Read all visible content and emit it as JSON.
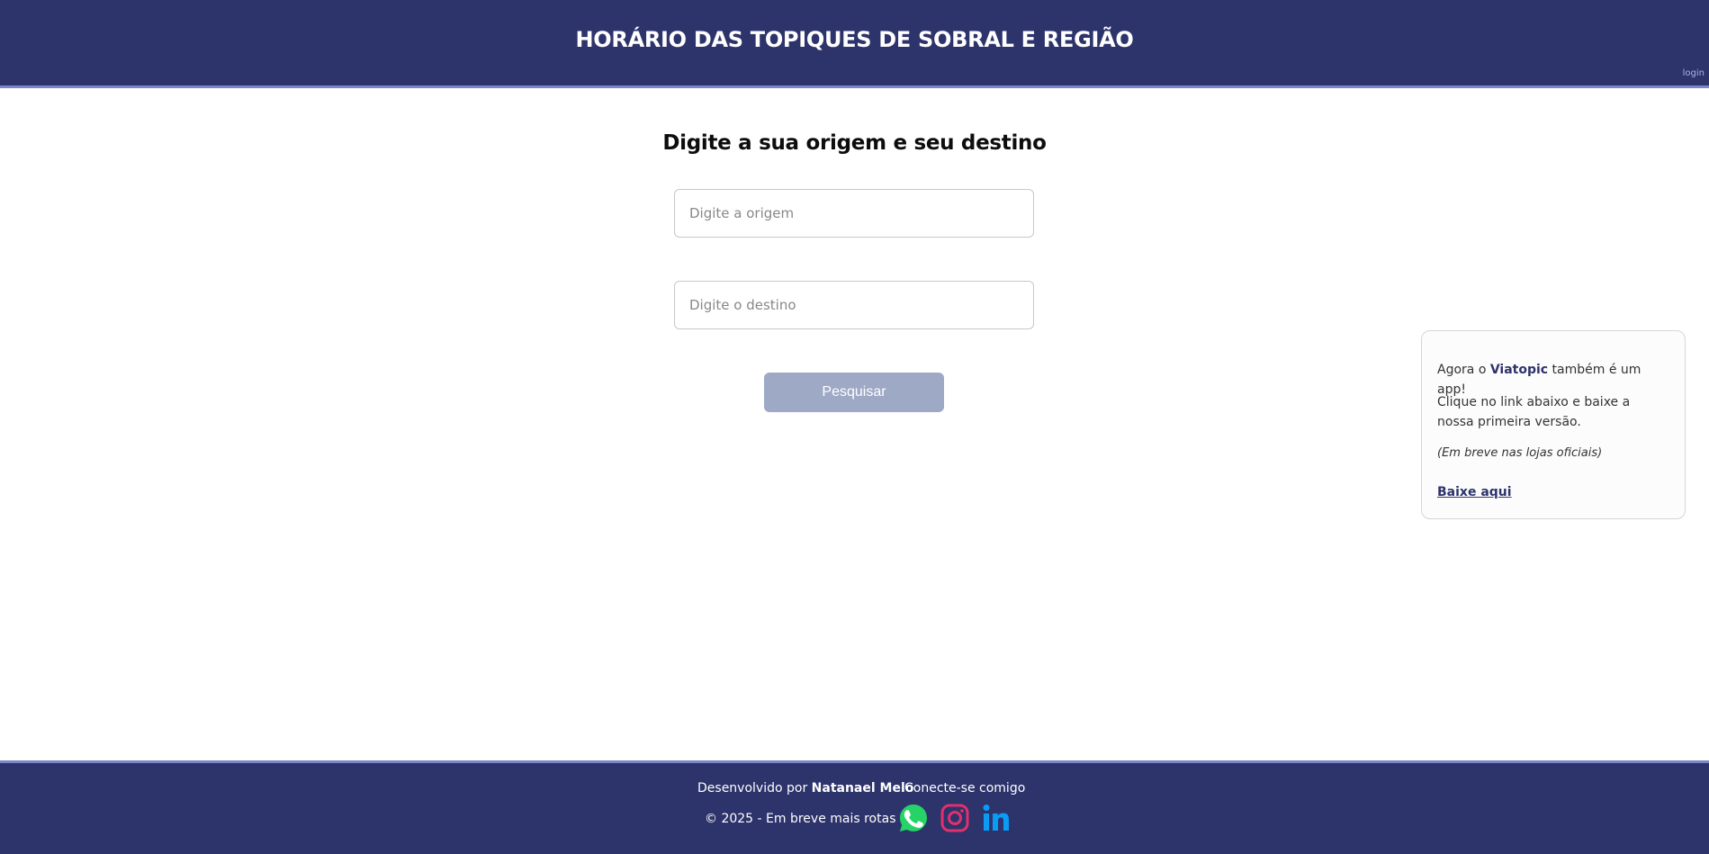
{
  "header": {
    "title": "HORÁRIO DAS TOPIQUES DE SOBRAL E REGIÃO",
    "login_label": "login"
  },
  "search": {
    "title": "Digite a sua origem e seu destino",
    "origin_placeholder": "Digite a origem",
    "destination_placeholder": "Digite o destino",
    "button_label": "Pesquisar"
  },
  "promo": {
    "line1_prefix": "Agora o ",
    "brand": "Viatopic",
    "line1_suffix": " também é um app!",
    "line2": "Clique no link abaixo e baixe a nossa primeira versão.",
    "line3": "(Em breve nas lojas oficiais)",
    "download_label": "Baixe aqui"
  },
  "footer": {
    "developed_by": "Desenvolvido por ",
    "developer_name": "Natanael Melo",
    "copyright": "© 2025 - Em breve mais rotas",
    "connect_label": "Conecte-se comigo",
    "social_icons": [
      "whatsapp-icon",
      "instagram-icon",
      "linkedin-icon"
    ]
  },
  "colors": {
    "header_bg": "#2d336b",
    "accent_line": "#7b86cc",
    "button_bg": "#9ea9c6",
    "whatsapp": "#25d366",
    "instagram": "#e1306c",
    "linkedin": "#0a9cf5"
  }
}
